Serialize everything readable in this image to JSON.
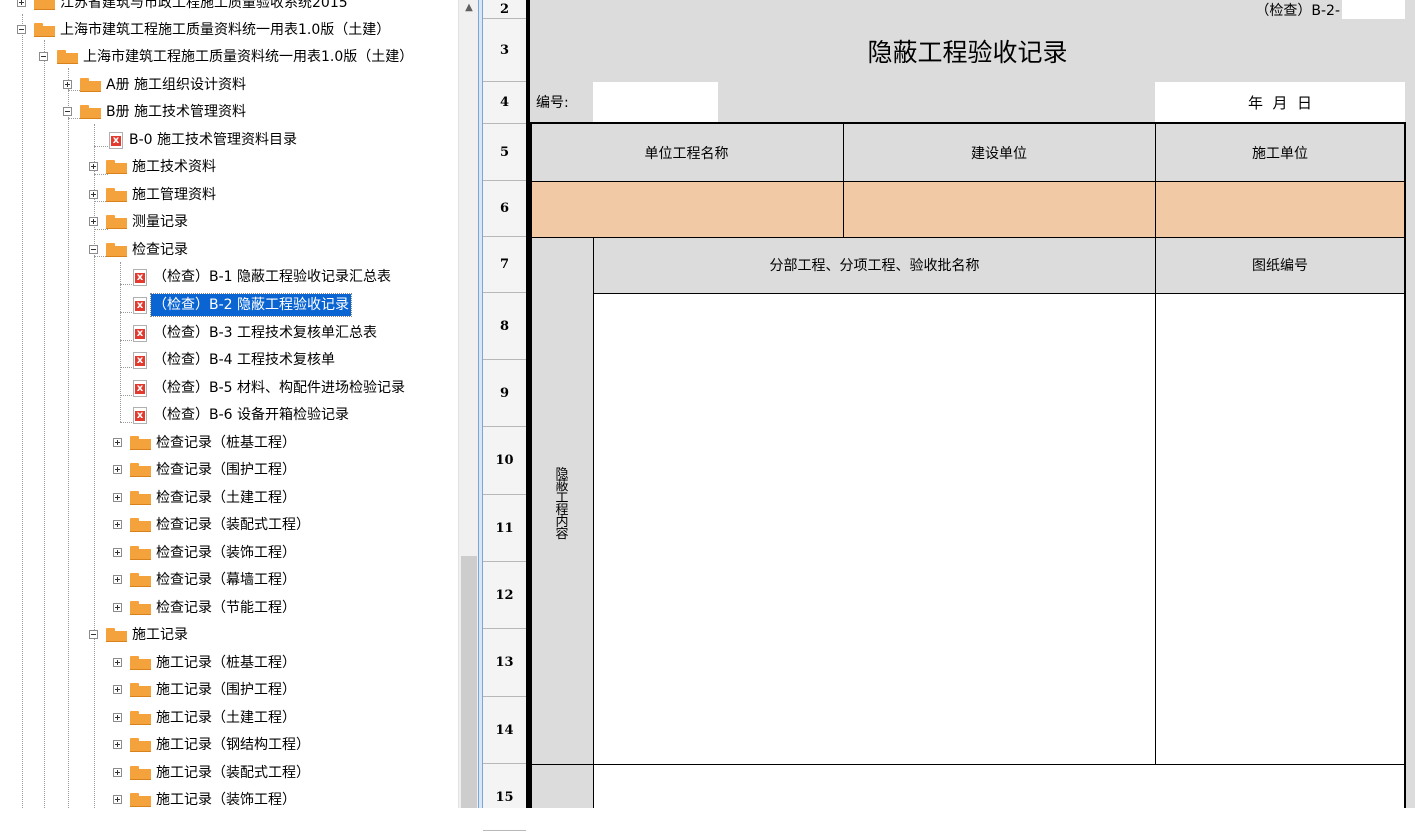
{
  "tree": {
    "items": [
      {
        "label": "江苏省建筑与市政工程施工质量验收系统2015",
        "icon": "folder-icon"
      },
      {
        "label": "上海市建筑工程施工质量资料统一用表1.0版（土建）",
        "icon": "folder-open-icon"
      },
      {
        "label": "上海市建筑工程施工质量资料统一用表1.0版（土建）",
        "icon": "folder-open-icon"
      },
      {
        "label": "A册 施工组织设计资料",
        "icon": "folder-icon"
      },
      {
        "label": "B册 施工技术管理资料",
        "icon": "folder-open-icon"
      },
      {
        "label": "B-0 施工技术管理资料目录",
        "icon": "excel-doc-icon"
      },
      {
        "label": "施工技术资料",
        "icon": "folder-icon"
      },
      {
        "label": "施工管理资料",
        "icon": "folder-icon"
      },
      {
        "label": "测量记录",
        "icon": "folder-icon"
      },
      {
        "label": "检查记录",
        "icon": "folder-open-icon"
      },
      {
        "label": "（检查）B-1 隐蔽工程验收记录汇总表",
        "icon": "excel-doc-icon"
      },
      {
        "label": "（检查）B-2 隐蔽工程验收记录",
        "icon": "excel-doc-icon",
        "selected": true
      },
      {
        "label": "（检查）B-3 工程技术复核单汇总表",
        "icon": "excel-doc-icon"
      },
      {
        "label": "（检查）B-4 工程技术复核单",
        "icon": "excel-doc-icon"
      },
      {
        "label": "（检查）B-5 材料、构配件进场检验记录",
        "icon": "excel-doc-icon"
      },
      {
        "label": "（检查）B-6 设备开箱检验记录",
        "icon": "excel-doc-icon"
      },
      {
        "label": "检查记录（桩基工程）",
        "icon": "folder-icon"
      },
      {
        "label": "检查记录（围护工程）",
        "icon": "folder-icon"
      },
      {
        "label": "检查记录（土建工程）",
        "icon": "folder-icon"
      },
      {
        "label": "检查记录（装配式工程）",
        "icon": "folder-icon"
      },
      {
        "label": "检查记录（装饰工程）",
        "icon": "folder-icon"
      },
      {
        "label": "检查记录（幕墙工程）",
        "icon": "folder-icon"
      },
      {
        "label": "检查记录（节能工程）",
        "icon": "folder-icon"
      },
      {
        "label": "施工记录",
        "icon": "folder-open-icon"
      },
      {
        "label": "施工记录（桩基工程）",
        "icon": "folder-icon"
      },
      {
        "label": "施工记录（围护工程）",
        "icon": "folder-icon"
      },
      {
        "label": "施工记录（土建工程）",
        "icon": "folder-icon"
      },
      {
        "label": "施工记录（钢结构工程）",
        "icon": "folder-icon"
      },
      {
        "label": "施工记录（装配式工程）",
        "icon": "folder-icon"
      },
      {
        "label": "施工记录（装饰工程）",
        "icon": "folder-icon"
      }
    ]
  },
  "rows": [
    "2",
    "3",
    "4",
    "5",
    "6",
    "7",
    "8",
    "9",
    "10",
    "11",
    "12",
    "13",
    "14",
    "15"
  ],
  "form": {
    "code": "（检查）B-2-",
    "title": "隐蔽工程验收记录",
    "number_label": "编号:",
    "date": "年  月  日",
    "unit_project_name": "单位工程名称",
    "builder": "建设单位",
    "constructor": "施工单位",
    "subitem_name": "分部工程、分项工程、验收批名称",
    "drawing_no": "图纸编号",
    "hidden_content": "隐蔽工程内容"
  },
  "colors": {
    "selection": "#0a64d2",
    "input_cell": "#f1c9a4",
    "sheet_bg": "#dcdcdc",
    "folder": "#f4a23c"
  }
}
